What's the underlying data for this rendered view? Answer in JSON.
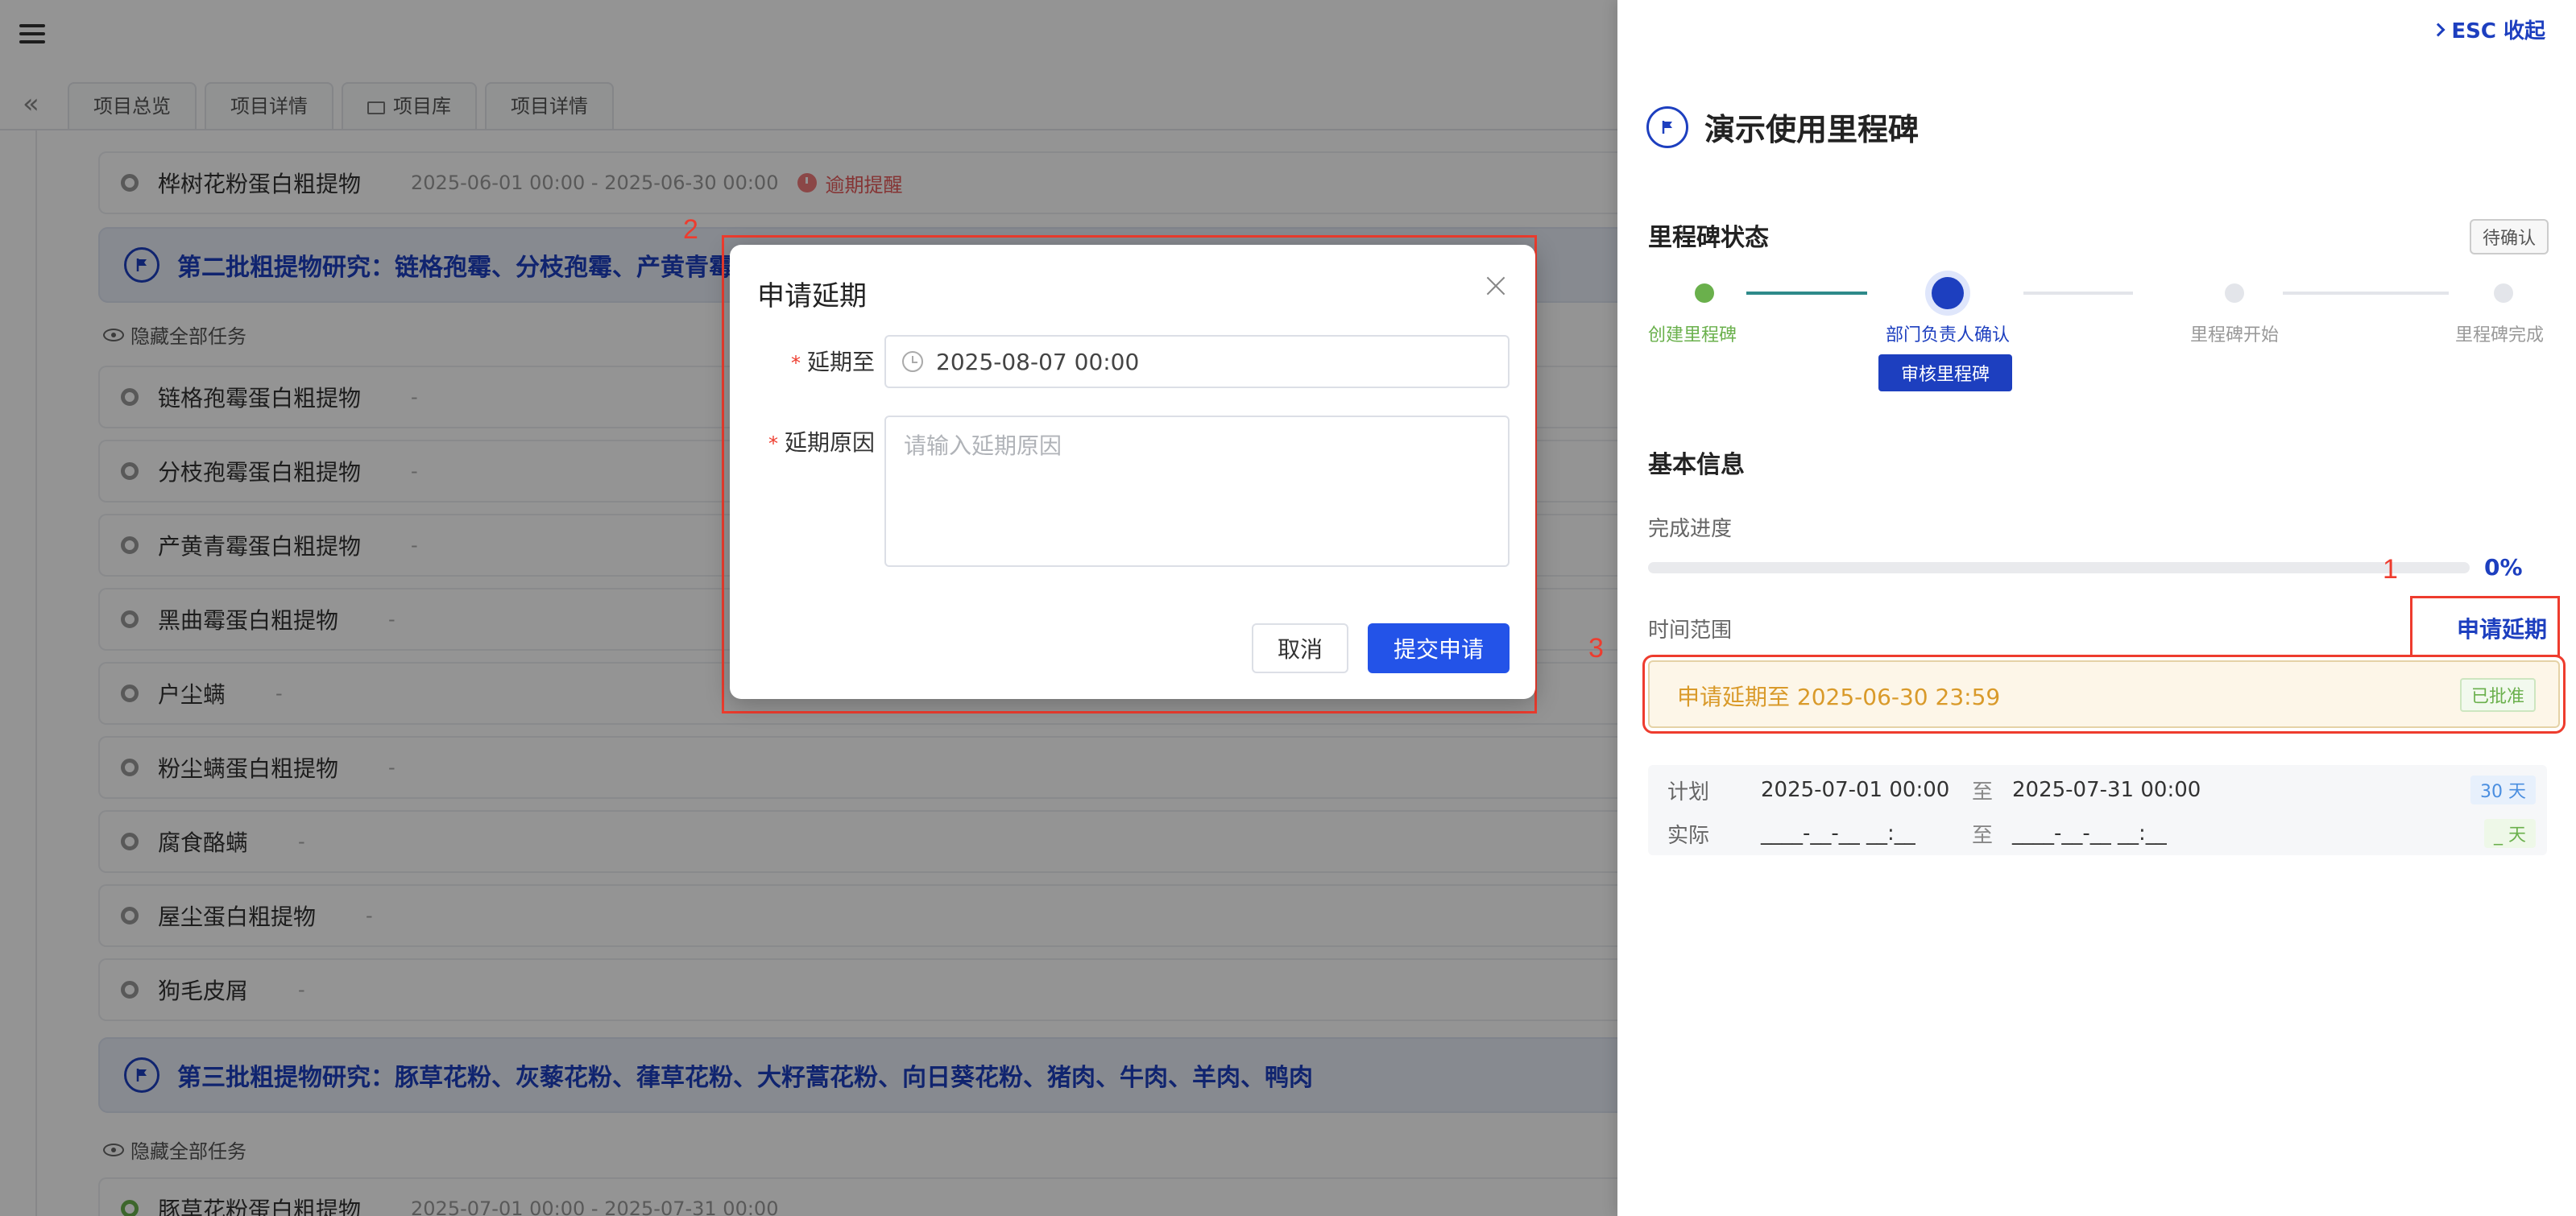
{
  "tabs": [
    "项目总览",
    "项目详情",
    "项目库",
    "项目详情"
  ],
  "task_row_1": {
    "name": "桦树花粉蛋白粗提物",
    "date": "2025-06-01 00:00 - 2025-06-30 00:00",
    "overdue": "逾期提醒"
  },
  "group_2": {
    "title": "第二批粗提物研究：链格孢霉、分枝孢霉、产黄青霉、",
    "hide_all": "隐藏全部任务"
  },
  "group_2_tasks": [
    {
      "name": "链格孢霉蛋白粗提物",
      "date": "-"
    },
    {
      "name": "分枝孢霉蛋白粗提物",
      "date": "-"
    },
    {
      "name": "产黄青霉蛋白粗提物",
      "date": "-"
    },
    {
      "name": "黑曲霉蛋白粗提物",
      "date": "-"
    },
    {
      "name": "户尘螨",
      "date": "-"
    },
    {
      "name": "粉尘螨蛋白粗提物",
      "date": "-"
    },
    {
      "name": "腐食酪螨",
      "date": "-"
    },
    {
      "name": "屋尘蛋白粗提物",
      "date": "-"
    },
    {
      "name": "狗毛皮屑",
      "date": "-"
    }
  ],
  "group_3": {
    "title": "第三批粗提物研究：豚草花粉、灰藜花粉、葎草花粉、大籽蒿花粉、向日葵花粉、猪肉、牛肉、羊肉、鸭肉",
    "hide_all": "隐藏全部任务"
  },
  "group_3_first_task": {
    "name": "豚草花粉蛋白粗提物",
    "date": "2025-07-01 00:00 - 2025-07-31 00:00"
  },
  "annotations": {
    "one": "1",
    "two": "2",
    "three": "3"
  },
  "modal": {
    "title": "申请延期",
    "date_label": "延期至",
    "date_value": "2025-08-07 00:00",
    "reason_label": "延期原因",
    "reason_placeholder": "请输入延期原因",
    "cancel": "取消",
    "submit": "提交申请",
    "required_mark": "*"
  },
  "panel": {
    "esc_label": "ESC 收起",
    "title": "演示使用里程碑",
    "status_title": "里程碑状态",
    "status_badge": "待确认",
    "steps": [
      "创建里程碑",
      "部门负责人确认",
      "里程碑开始",
      "里程碑完成"
    ],
    "audit_button": "审核里程碑",
    "basic_info_title": "基本信息",
    "progress_label": "完成进度",
    "progress_value": "0%",
    "progress_fraction": 0,
    "time_range_label": "时间范围",
    "apply_link": "申请延期",
    "extension_text": "申请延期至 2025-06-30 23:59",
    "extension_status": "已批准",
    "plan_label": "计划",
    "plan_start": "2025-07-01 00:00",
    "plan_to": "至",
    "plan_end": "2025-07-31 00:00",
    "plan_days": "30 天",
    "actual_label": "实际",
    "actual_start": "____-__-__ __:__",
    "actual_to": "至",
    "actual_end": "____-__-__ __:__",
    "actual_days": "_ 天"
  },
  "colors": {
    "accent": "#2353e8",
    "brand_dark": "#1d3fbf",
    "warning": "#d99a2a",
    "success": "#6ab04c",
    "annotation": "#ee3c2e"
  }
}
